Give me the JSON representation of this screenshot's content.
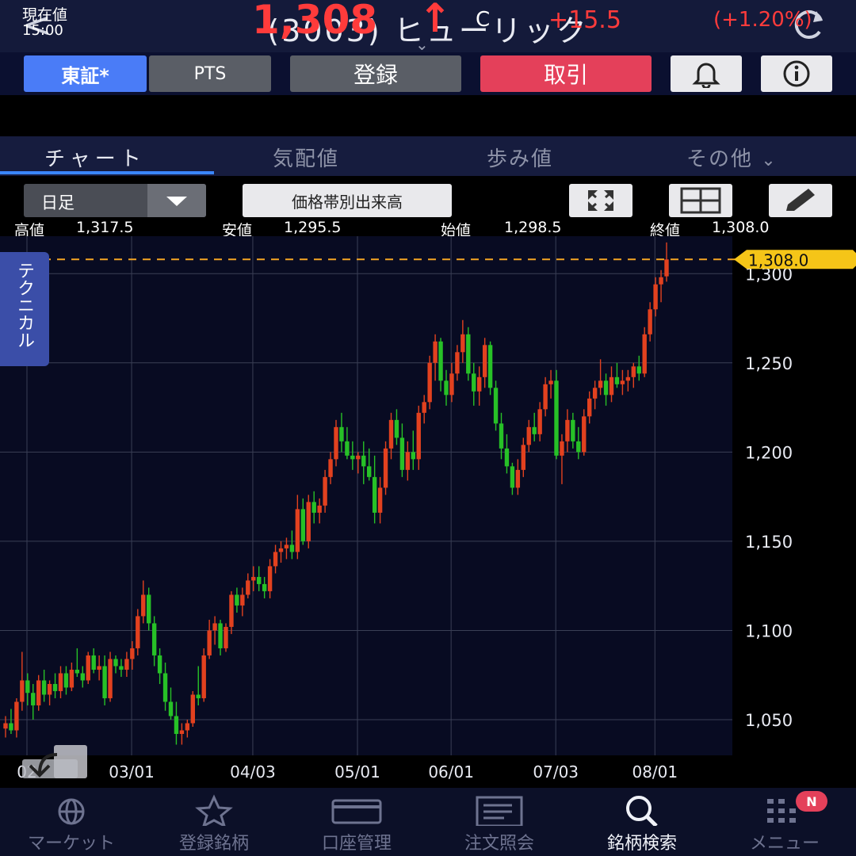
{
  "header": {
    "back_icon": "chevron-left-icon",
    "title": "(3003) ヒューリック",
    "refresh_icon": "refresh-icon"
  },
  "toolbar": {
    "market_tse": "東証*",
    "market_pts": "PTS",
    "register": "登録",
    "trade": "取引",
    "bell_icon": "bell-icon",
    "info_icon": "info-icon"
  },
  "quote": {
    "label": "現在値",
    "time": "15:00",
    "price": "1,308",
    "arrow": "↑",
    "flag": "C",
    "change": "+15.5",
    "change_pct": "(+1.20%)",
    "up_color": "#ff3b3b"
  },
  "tabs": {
    "chart": "チャート",
    "board": "気配値",
    "ticks": "歩み値",
    "other": "その他"
  },
  "controls": {
    "period": "日足",
    "volume_profile": "価格帯別出来高"
  },
  "ohlc": {
    "high_label": "高値",
    "high": "1,317.5",
    "low_label": "安値",
    "low": "1,295.5",
    "open_label": "始値",
    "open": "1,298.5",
    "close_label": "終値",
    "close": "1,308.0"
  },
  "technical_tab": "テクニカル",
  "chart_data": {
    "type": "candlestick",
    "ylim": [
      1030,
      1321
    ],
    "y_ticks": [
      1050,
      1100,
      1150,
      1200,
      1250,
      1300
    ],
    "y_tick_labels": [
      "1,050",
      "1,100",
      "1,150",
      "1,200",
      "1,250",
      "1,300"
    ],
    "x_ticks": [
      {
        "label": "02",
        "index": 0
      },
      {
        "label": "03/01",
        "index": 19
      },
      {
        "label": "04/03",
        "index": 41
      },
      {
        "label": "05/01",
        "index": 60
      },
      {
        "label": "06/01",
        "index": 77
      },
      {
        "label": "07/03",
        "index": 96
      },
      {
        "label": "08/01",
        "index": 114
      }
    ],
    "last_price": 1308.0,
    "last_price_label": "1,308.0",
    "up_color": "#e2411f",
    "down_color": "#27c127",
    "candles": [
      [
        1045,
        1052,
        1040,
        1048
      ],
      [
        1048,
        1056,
        1042,
        1044
      ],
      [
        1044,
        1062,
        1040,
        1060
      ],
      [
        1060,
        1088,
        1055,
        1072
      ],
      [
        1072,
        1076,
        1058,
        1065
      ],
      [
        1065,
        1070,
        1050,
        1058
      ],
      [
        1058,
        1075,
        1055,
        1072
      ],
      [
        1072,
        1078,
        1060,
        1064
      ],
      [
        1064,
        1072,
        1058,
        1070
      ],
      [
        1070,
        1076,
        1062,
        1066
      ],
      [
        1066,
        1080,
        1062,
        1076
      ],
      [
        1076,
        1080,
        1064,
        1068
      ],
      [
        1068,
        1082,
        1066,
        1078
      ],
      [
        1078,
        1090,
        1074,
        1076
      ],
      [
        1076,
        1080,
        1068,
        1072
      ],
      [
        1072,
        1088,
        1070,
        1086
      ],
      [
        1086,
        1090,
        1076,
        1078
      ],
      [
        1078,
        1086,
        1072,
        1080
      ],
      [
        1080,
        1086,
        1058,
        1062
      ],
      [
        1062,
        1088,
        1060,
        1084
      ],
      [
        1084,
        1086,
        1076,
        1080
      ],
      [
        1080,
        1084,
        1074,
        1078
      ],
      [
        1078,
        1088,
        1074,
        1084
      ],
      [
        1084,
        1094,
        1078,
        1090
      ],
      [
        1090,
        1112,
        1086,
        1108
      ],
      [
        1108,
        1128,
        1104,
        1120
      ],
      [
        1120,
        1124,
        1100,
        1104
      ],
      [
        1104,
        1108,
        1080,
        1086
      ],
      [
        1086,
        1090,
        1070,
        1076
      ],
      [
        1076,
        1082,
        1055,
        1060
      ],
      [
        1060,
        1068,
        1050,
        1052
      ],
      [
        1052,
        1060,
        1036,
        1042
      ],
      [
        1042,
        1048,
        1036,
        1044
      ],
      [
        1044,
        1050,
        1040,
        1048
      ],
      [
        1048,
        1066,
        1046,
        1064
      ],
      [
        1064,
        1080,
        1058,
        1062
      ],
      [
        1062,
        1090,
        1060,
        1086
      ],
      [
        1086,
        1106,
        1084,
        1100
      ],
      [
        1100,
        1108,
        1092,
        1104
      ],
      [
        1104,
        1106,
        1086,
        1090
      ],
      [
        1090,
        1104,
        1088,
        1102
      ],
      [
        1102,
        1122,
        1098,
        1120
      ],
      [
        1120,
        1124,
        1110,
        1114
      ],
      [
        1114,
        1124,
        1108,
        1120
      ],
      [
        1120,
        1132,
        1118,
        1128
      ],
      [
        1128,
        1136,
        1122,
        1130
      ],
      [
        1130,
        1136,
        1122,
        1126
      ],
      [
        1126,
        1130,
        1118,
        1122
      ],
      [
        1122,
        1140,
        1118,
        1136
      ],
      [
        1136,
        1148,
        1132,
        1144
      ],
      [
        1144,
        1150,
        1138,
        1146
      ],
      [
        1146,
        1152,
        1140,
        1148
      ],
      [
        1148,
        1156,
        1140,
        1144
      ],
      [
        1144,
        1176,
        1140,
        1168
      ],
      [
        1168,
        1174,
        1148,
        1150
      ],
      [
        1150,
        1176,
        1146,
        1172
      ],
      [
        1172,
        1178,
        1160,
        1166
      ],
      [
        1166,
        1174,
        1160,
        1170
      ],
      [
        1170,
        1190,
        1166,
        1186
      ],
      [
        1186,
        1200,
        1182,
        1196
      ],
      [
        1196,
        1218,
        1192,
        1214
      ],
      [
        1214,
        1222,
        1200,
        1206
      ],
      [
        1206,
        1214,
        1196,
        1198
      ],
      [
        1198,
        1206,
        1190,
        1196
      ],
      [
        1196,
        1200,
        1188,
        1198
      ],
      [
        1198,
        1206,
        1182,
        1192
      ],
      [
        1192,
        1202,
        1184,
        1186
      ],
      [
        1186,
        1198,
        1160,
        1166
      ],
      [
        1166,
        1186,
        1160,
        1180
      ],
      [
        1180,
        1206,
        1176,
        1202
      ],
      [
        1202,
        1222,
        1196,
        1218
      ],
      [
        1218,
        1224,
        1204,
        1208
      ],
      [
        1208,
        1216,
        1186,
        1190
      ],
      [
        1190,
        1206,
        1184,
        1200
      ],
      [
        1200,
        1212,
        1190,
        1196
      ],
      [
        1196,
        1226,
        1190,
        1222
      ],
      [
        1222,
        1232,
        1216,
        1228
      ],
      [
        1228,
        1254,
        1224,
        1250
      ],
      [
        1250,
        1266,
        1240,
        1262
      ],
      [
        1262,
        1264,
        1234,
        1240
      ],
      [
        1240,
        1246,
        1226,
        1232
      ],
      [
        1232,
        1250,
        1228,
        1244
      ],
      [
        1244,
        1260,
        1240,
        1256
      ],
      [
        1256,
        1274,
        1250,
        1266
      ],
      [
        1266,
        1270,
        1240,
        1244
      ],
      [
        1244,
        1250,
        1226,
        1234
      ],
      [
        1234,
        1248,
        1226,
        1242
      ],
      [
        1242,
        1264,
        1236,
        1260
      ],
      [
        1260,
        1262,
        1232,
        1236
      ],
      [
        1236,
        1240,
        1212,
        1216
      ],
      [
        1216,
        1222,
        1196,
        1202
      ],
      [
        1202,
        1210,
        1188,
        1192
      ],
      [
        1192,
        1194,
        1176,
        1180
      ],
      [
        1180,
        1196,
        1176,
        1190
      ],
      [
        1190,
        1208,
        1186,
        1204
      ],
      [
        1204,
        1218,
        1200,
        1214
      ],
      [
        1214,
        1222,
        1206,
        1210
      ],
      [
        1210,
        1228,
        1206,
        1224
      ],
      [
        1224,
        1242,
        1220,
        1238
      ],
      [
        1238,
        1246,
        1230,
        1240
      ],
      [
        1240,
        1246,
        1196,
        1198
      ],
      [
        1198,
        1210,
        1182,
        1206
      ],
      [
        1206,
        1224,
        1200,
        1218
      ],
      [
        1218,
        1222,
        1202,
        1206
      ],
      [
        1206,
        1214,
        1196,
        1200
      ],
      [
        1200,
        1224,
        1198,
        1220
      ],
      [
        1220,
        1234,
        1216,
        1230
      ],
      [
        1230,
        1240,
        1224,
        1236
      ],
      [
        1236,
        1252,
        1232,
        1240
      ],
      [
        1240,
        1244,
        1226,
        1232
      ],
      [
        1232,
        1248,
        1228,
        1242
      ],
      [
        1242,
        1250,
        1236,
        1238
      ],
      [
        1238,
        1246,
        1232,
        1240
      ],
      [
        1240,
        1246,
        1234,
        1242
      ],
      [
        1242,
        1250,
        1236,
        1248
      ],
      [
        1248,
        1254,
        1240,
        1244
      ],
      [
        1244,
        1270,
        1242,
        1266
      ],
      [
        1266,
        1284,
        1262,
        1280
      ],
      [
        1280,
        1298,
        1276,
        1294
      ],
      [
        1294,
        1302,
        1284,
        1298
      ],
      [
        1298.5,
        1317.5,
        1295.5,
        1308
      ]
    ]
  },
  "nav": [
    {
      "label": "マーケット",
      "icon": "globe-icon"
    },
    {
      "label": "登録銘柄",
      "icon": "star-icon"
    },
    {
      "label": "口座管理",
      "icon": "card-icon"
    },
    {
      "label": "注文照会",
      "icon": "document-icon"
    },
    {
      "label": "銘柄検索",
      "icon": "search-icon"
    },
    {
      "label": "メニュー",
      "icon": "grid-menu-icon"
    }
  ],
  "nav_badge": "N"
}
